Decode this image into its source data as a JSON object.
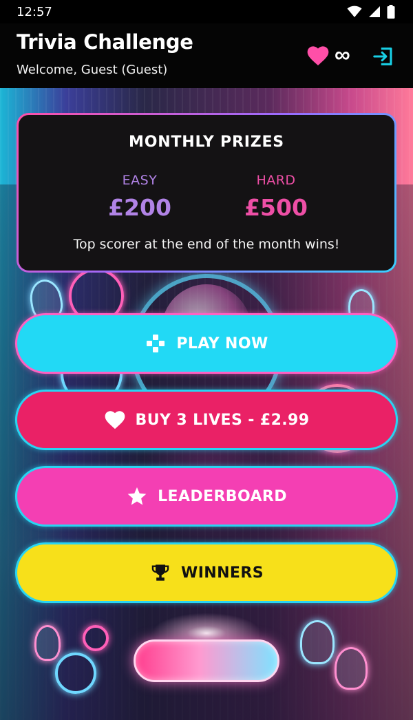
{
  "status_bar": {
    "time": "12:57"
  },
  "header": {
    "title": "Trivia Challenge",
    "subtitle": "Welcome, Guest (Guest)",
    "lives_count": "∞"
  },
  "prizes": {
    "title": "MONTHLY PRIZES",
    "easy": {
      "label": "EASY",
      "amount": "£200"
    },
    "hard": {
      "label": "HARD",
      "amount": "£500"
    },
    "footer": "Top scorer at the end of the month wins!"
  },
  "buttons": {
    "play": "PLAY NOW",
    "buy_lives": "BUY 3 LIVES - £2.99",
    "leaderboard": "LEADERBOARD",
    "winners": "WINNERS"
  },
  "icons": {
    "lives": "heart-icon",
    "logout": "logout-icon",
    "play": "gamepad-icon",
    "buy": "heart-icon",
    "leaderboard": "star-icon",
    "winners": "trophy-icon"
  },
  "colors": {
    "play": "#22d9f5",
    "buy": "#ea2166",
    "leaderboard": "#f43fb3",
    "winners": "#f7e01a",
    "easy": "#b183e6",
    "hard": "#ee4fa6",
    "logout": "#18d0e6"
  }
}
